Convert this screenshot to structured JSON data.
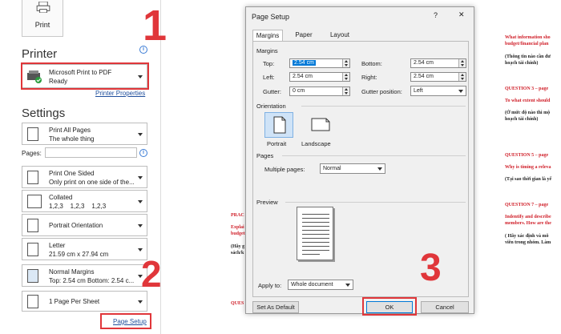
{
  "backstage": {
    "print_button": "Print",
    "printer_heading": "Printer",
    "printer": {
      "name": "Microsoft Print to PDF",
      "status": "Ready"
    },
    "printer_properties": "Printer Properties",
    "settings_heading": "Settings",
    "pages_label": "Pages:",
    "pages_value": "",
    "settings": [
      {
        "line1": "Print All Pages",
        "line2": "The whole thing"
      },
      {
        "line1": "Print One Sided",
        "line2": "Only print on one side of the..."
      },
      {
        "line1": "Collated",
        "line2": "1,2,3    1,2,3    1,2,3"
      },
      {
        "line1": "Portrait Orientation",
        "line2": ""
      },
      {
        "line1": "Letter",
        "line2": "21.59 cm x 27.94 cm"
      },
      {
        "line1": "Normal Margins",
        "line2": "Top: 2.54 cm Bottom: 2.54 c..."
      },
      {
        "line1": "1 Page Per Sheet",
        "line2": ""
      }
    ],
    "page_setup_link": "Page Setup"
  },
  "annotations": {
    "n1": "1",
    "n2": "2",
    "n3": "3",
    "accent": "#e0363a"
  },
  "dialog": {
    "title": "Page Setup",
    "help": "?",
    "close": "✕",
    "tabs": [
      "Margins",
      "Paper",
      "Layout"
    ],
    "margins_group": "Margins",
    "top_label": "Top:",
    "top_value": "2.54 cm",
    "bottom_label": "Bottom:",
    "bottom_value": "2.54 cm",
    "left_label": "Left:",
    "left_value": "2.54 cm",
    "right_label": "Right:",
    "right_value": "2.54 cm",
    "gutter_label": "Gutter:",
    "gutter_value": "0 cm",
    "gutter_pos_label": "Gutter position:",
    "gutter_pos_value": "Left",
    "orientation_group": "Orientation",
    "portrait": "Portrait",
    "landscape": "Landscape",
    "pages_group": "Pages",
    "multiple_pages_label": "Multiple pages:",
    "multiple_pages_value": "Normal",
    "preview_group": "Preview",
    "apply_label": "Apply to:",
    "apply_value": "Whole document",
    "set_default": "Set As Default",
    "ok": "OK",
    "cancel": "Cancel"
  },
  "document": {
    "red_lines": [
      "What information sho",
      "QUESTION 3 – page",
      "To what extent should",
      "QUESTION 5 – page",
      "Why is timing a releva",
      "QUESTION 7 – page",
      "Indentify and describe",
      "PRAC",
      "Explai",
      "QUES"
    ],
    "black_lines": [
      "budget/financial plan",
      "(Thông tin nào cần đư",
      "hoạch tài chính)",
      "(Ở mức độ nào thì mộ",
      "hoạch tài chính)",
      "(Tại sao thời gian là yế",
      "members. How are the",
      "( Hãy xác định và mô",
      "viên trong nhóm. Làm",
      "budget",
      "(Hãy g",
      "sách/k"
    ]
  }
}
